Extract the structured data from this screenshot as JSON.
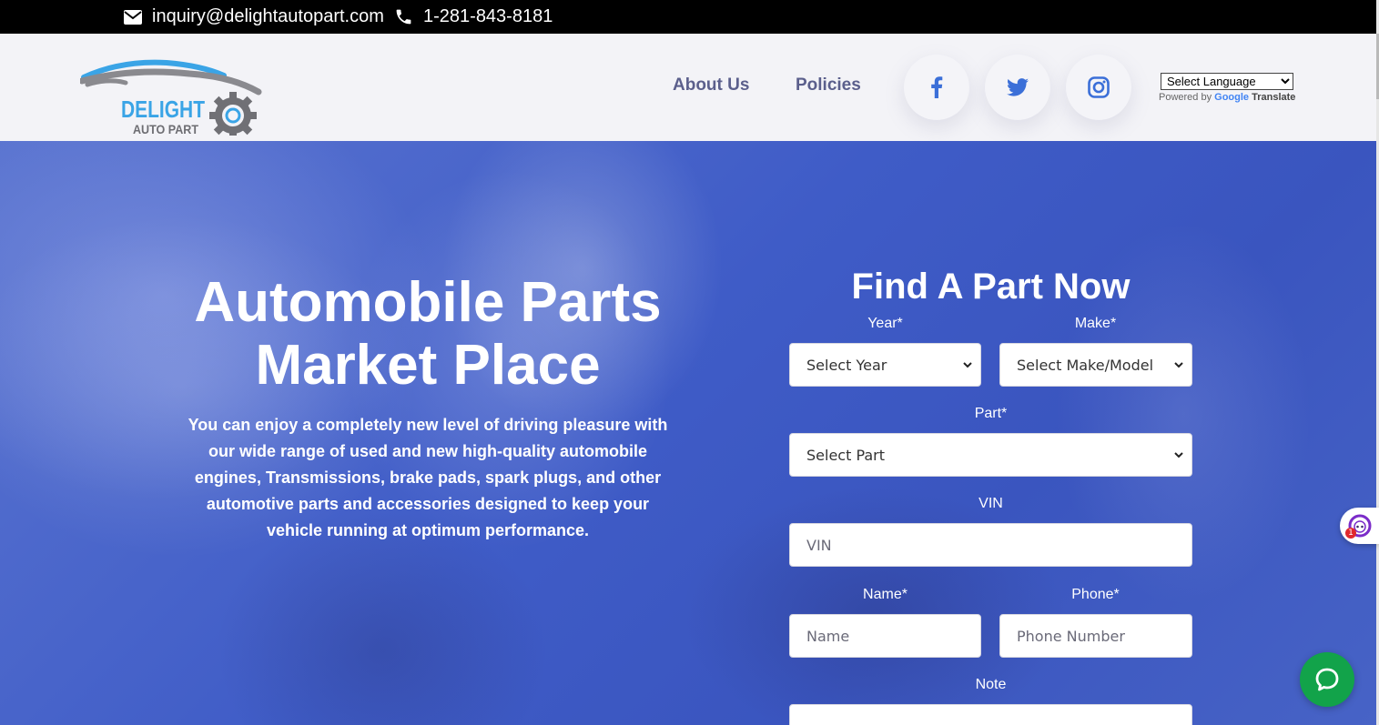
{
  "topbar": {
    "email": "inquiry@delightautopart.com",
    "phone": "1-281-843-8181"
  },
  "header": {
    "logo": {
      "line1": "DELIGHT",
      "line2": "AUTO PART"
    },
    "nav": [
      {
        "label": "About Us"
      },
      {
        "label": "Policies"
      }
    ],
    "social": [
      "facebook-icon",
      "twitter-icon",
      "instagram-icon"
    ],
    "language": {
      "selected": "Select Language",
      "powered_by": "Powered by",
      "google": "Google",
      "translate": "Translate"
    }
  },
  "hero": {
    "title_line1": "Automobile Parts",
    "title_line2": "Market Place",
    "description": "You can enjoy a completely new level of driving pleasure with our wide range of used and new high-quality automobile engines, Transmissions, brake pads, spark plugs, and other automotive parts and accessories designed to keep your vehicle running at optimum performance."
  },
  "form": {
    "title": "Find A Part Now",
    "year": {
      "label": "Year*",
      "value": "Select Year"
    },
    "make": {
      "label": "Make*",
      "value": "Select Make/Model"
    },
    "part": {
      "label": "Part*",
      "value": "Select Part"
    },
    "vin": {
      "label": "VIN",
      "placeholder": "VIN"
    },
    "name": {
      "label": "Name*",
      "placeholder": "Name"
    },
    "phone": {
      "label": "Phone*",
      "placeholder": "Phone Number"
    },
    "note": {
      "label": "Note"
    }
  },
  "widgets": {
    "badge_count": "1"
  },
  "colors": {
    "topbar": "#000000",
    "header_bg": "#f3f3f7",
    "nav_text": "#5b5f8c",
    "hero_blue": "#3f5cc7",
    "social_icon": "#3b6fd8",
    "chat_green": "#12a34a"
  }
}
